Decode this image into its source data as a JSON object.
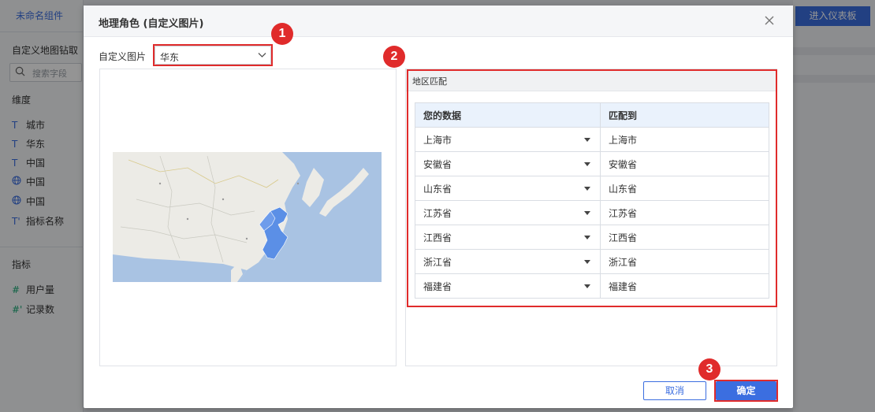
{
  "app": {
    "component_name": "未命名组件",
    "drill_title": "自定义地图钻取",
    "search_placeholder": "搜索字段",
    "dimension_label": "维度",
    "dimensions": [
      {
        "icon": "T",
        "label": "城市"
      },
      {
        "icon": "T",
        "label": "华东"
      },
      {
        "icon": "T",
        "label": "中国"
      },
      {
        "icon": "globe",
        "label": "中国"
      },
      {
        "icon": "globe",
        "label": "中国"
      },
      {
        "icon": "T'",
        "label": "指标名称"
      }
    ],
    "metric_label": "指标",
    "metrics": [
      {
        "icon": "#",
        "label": "用户量"
      },
      {
        "icon": "#'",
        "label": "记录数"
      }
    ],
    "enter_dashboard_label": "进入仪表板"
  },
  "dialog": {
    "title": "地理角色 (自定义图片)",
    "picture_label": "自定义图片",
    "picture_value": "华东",
    "match_panel_title": "地区匹配",
    "table_headers": [
      "您的数据",
      "匹配到"
    ],
    "rows": [
      {
        "data": "上海市",
        "match": "上海市"
      },
      {
        "data": "安徽省",
        "match": "安徽省"
      },
      {
        "data": "山东省",
        "match": "山东省"
      },
      {
        "data": "江苏省",
        "match": "江苏省"
      },
      {
        "data": "江西省",
        "match": "江西省"
      },
      {
        "data": "浙江省",
        "match": "浙江省"
      },
      {
        "data": "福建省",
        "match": "福建省"
      }
    ],
    "cancel_label": "取消",
    "ok_label": "确定"
  },
  "callouts": [
    "1",
    "2",
    "3"
  ],
  "colors": {
    "accent": "#3b6ee0",
    "highlight": "#e02b2b",
    "map_region": "#5b8fe6",
    "map_sea": "#a9c3e3"
  }
}
